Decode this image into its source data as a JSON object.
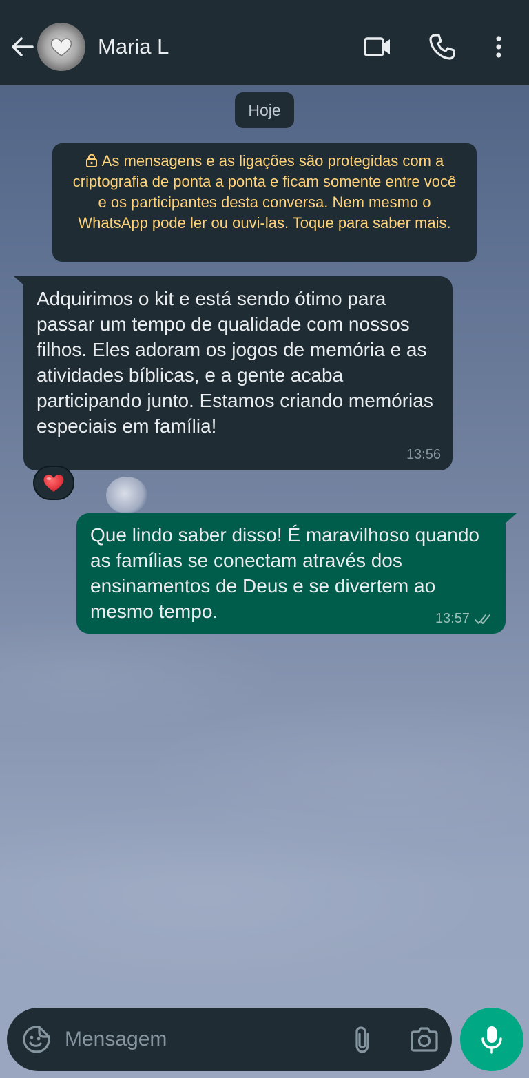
{
  "header": {
    "contact_name": "Maria L",
    "icons": [
      "back-arrow-icon",
      "video-call-icon",
      "phone-icon",
      "more-options-icon"
    ]
  },
  "chat": {
    "date_label": "Hoje",
    "encryption_notice": "As mensagens e as ligações são protegidas com a criptografia de ponta a ponta e ficam somente entre você e os participantes desta conversa. Nem mesmo o WhatsApp pode ler ou ouvi-las. Toque para saber mais.",
    "messages": [
      {
        "direction": "incoming",
        "text": "Adquirimos o kit e está sendo ótimo para passar um tempo de qualidade com nossos filhos. Eles adoram os jogos de memória e as atividades bíblicas, e a gente acaba participando junto. Estamos criando memórias especiais em família!",
        "time": "13:56",
        "reaction": "❤️"
      },
      {
        "direction": "outgoing",
        "text": "Que lindo saber disso! É maravilhoso quando as famílias se conectam através dos ensinamentos de Deus e se divertem ao mesmo tempo.",
        "time": "13:57",
        "status_icon": "double-check-icon"
      }
    ]
  },
  "composer": {
    "placeholder": "Mensagem",
    "icons": [
      "emoji-sticker-icon",
      "paperclip-icon",
      "camera-icon",
      "microphone-icon"
    ]
  },
  "colors": {
    "header_bg": "#1f2c34",
    "incoming_bubble": "#1f2c34",
    "outgoing_bubble": "#005c4b",
    "notice_text": "#ffd279",
    "mic_button": "#00a884"
  }
}
